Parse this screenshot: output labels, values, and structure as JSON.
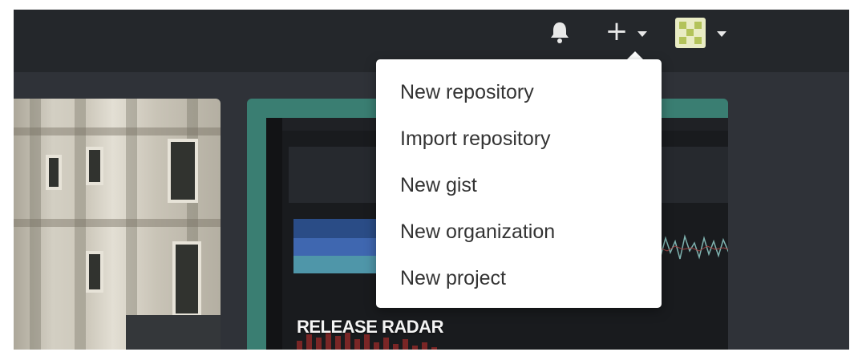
{
  "header": {
    "notifications_icon": "bell-icon",
    "create_icon": "plus-icon",
    "avatar_icon": "identicon-avatar",
    "colors": {
      "header_bg": "#24272b",
      "icon": "#e8e8e8"
    }
  },
  "create_menu": {
    "items": [
      {
        "label": "New repository"
      },
      {
        "label": "Import repository"
      },
      {
        "label": "New gist"
      },
      {
        "label": "New organization"
      },
      {
        "label": "New project"
      }
    ]
  },
  "cards": {
    "release_radar": {
      "title": "RELEASE RADAR",
      "color": "#3a7e72"
    }
  }
}
